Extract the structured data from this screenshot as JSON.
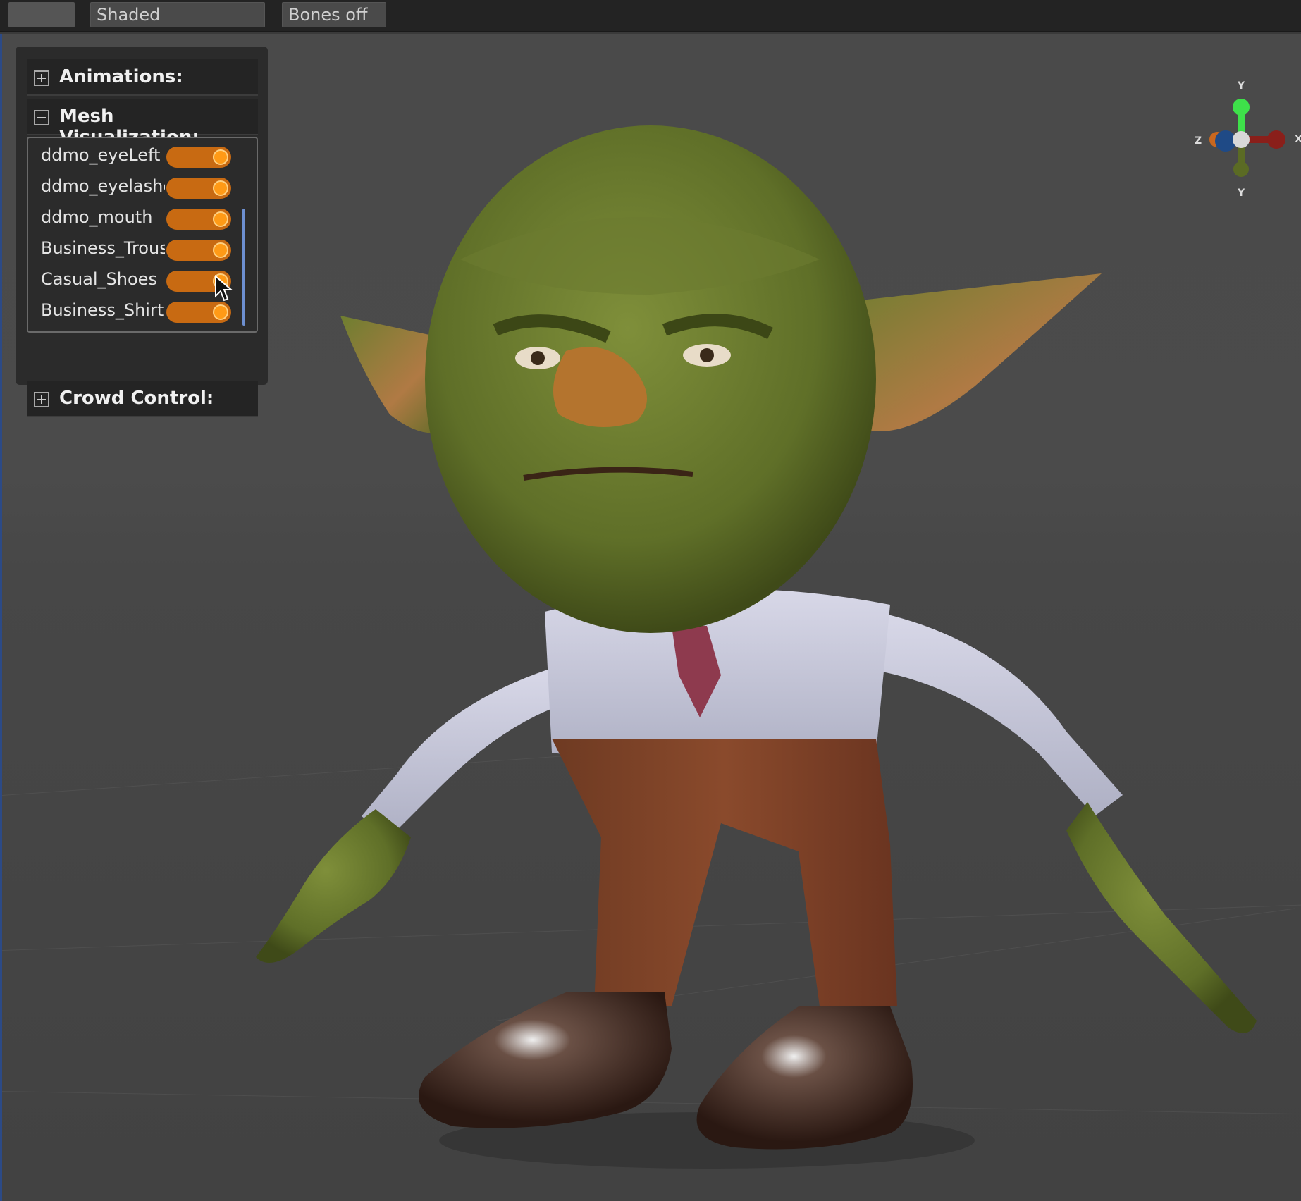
{
  "toolbar": {
    "shading_mode": "Shaded",
    "bones_mode": "Bones off"
  },
  "panel": {
    "sections": {
      "animations": {
        "title": "Animations:",
        "expanded": false
      },
      "mesh_visualization": {
        "title": "Mesh Visualization:",
        "expanded": true
      },
      "crowd_control": {
        "title": "Crowd Control:",
        "expanded": false
      }
    },
    "meshes": [
      {
        "label": "ddmo_eyeLeft",
        "enabled": true
      },
      {
        "label": "ddmo_eyelashes",
        "enabled": true
      },
      {
        "label": "ddmo_mouth",
        "enabled": true
      },
      {
        "label": "Business_Trousers",
        "enabled": true
      },
      {
        "label": "Casual_Shoes",
        "enabled": true
      },
      {
        "label": "Business_Shirt",
        "enabled": true
      }
    ]
  },
  "gizmo": {
    "labels": {
      "y_top": "Y",
      "y_bottom": "Y",
      "x": "X",
      "z": "Z"
    },
    "colors": {
      "y_pos": "#3ee04a",
      "y_neg": "#5b6b24",
      "x_pos": "#8a1f1a",
      "x_neg": "#c9671e",
      "z_pos": "#1f4a86",
      "center": "#d8d8d8"
    }
  },
  "colors": {
    "toggle_track": "#c86a12",
    "toggle_knob": "#ff9a16",
    "viewport_border": "#2c4a86"
  }
}
